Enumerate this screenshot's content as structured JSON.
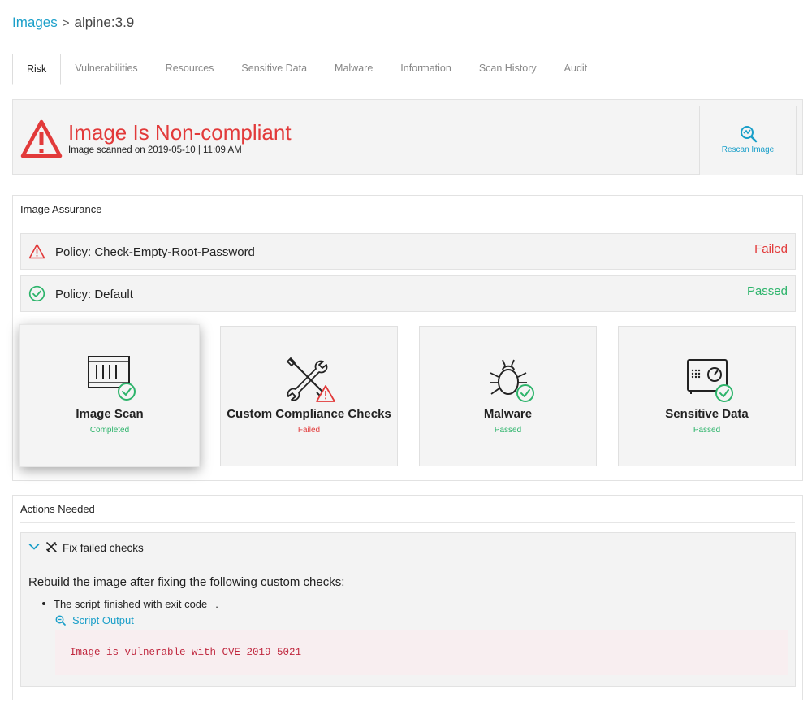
{
  "breadcrumb": {
    "parent": "Images",
    "separator": ">",
    "current": "alpine:3.9"
  },
  "tabs": [
    {
      "label": "Risk",
      "active": true
    },
    {
      "label": "Vulnerabilities"
    },
    {
      "label": "Resources"
    },
    {
      "label": "Sensitive Data"
    },
    {
      "label": "Malware"
    },
    {
      "label": "Information"
    },
    {
      "label": "Scan History"
    },
    {
      "label": "Audit"
    }
  ],
  "status": {
    "title": "Image Is Non-compliant",
    "subtitle": "Image scanned on 2019-05-10 | 11:09 AM",
    "icon": "warning-triangle-icon",
    "rescan_label": "Rescan Image"
  },
  "assurance": {
    "title": "Image Assurance",
    "policies": [
      {
        "label": "Policy: Check-Empty-Root-Password",
        "status": "Failed",
        "icon": "warning-triangle-icon"
      },
      {
        "label": "Policy: Default",
        "status": "Passed",
        "icon": "check-circle-icon"
      }
    ],
    "cards": [
      {
        "title": "Image Scan",
        "status": "Completed",
        "icon": "barcode-scan-icon"
      },
      {
        "title": "Custom Compliance Checks",
        "status": "Failed",
        "icon": "tools-icon"
      },
      {
        "title": "Malware",
        "status": "Passed",
        "icon": "bug-icon"
      },
      {
        "title": "Sensitive Data",
        "status": "Passed",
        "icon": "safe-icon"
      }
    ]
  },
  "actions": {
    "title": "Actions Needed",
    "fix": {
      "label": "Fix failed checks",
      "body": "Rebuild the image after fixing the following custom checks:",
      "bullet_a": "The script",
      "bullet_b": "finished with exit code",
      "bullet_c": ".",
      "link": "Script Output",
      "code": "Image is vulnerable with CVE-2019-5021"
    }
  },
  "colors": {
    "accent": "#1a9fc9",
    "danger": "#e23a3a",
    "success": "#2db46b"
  }
}
